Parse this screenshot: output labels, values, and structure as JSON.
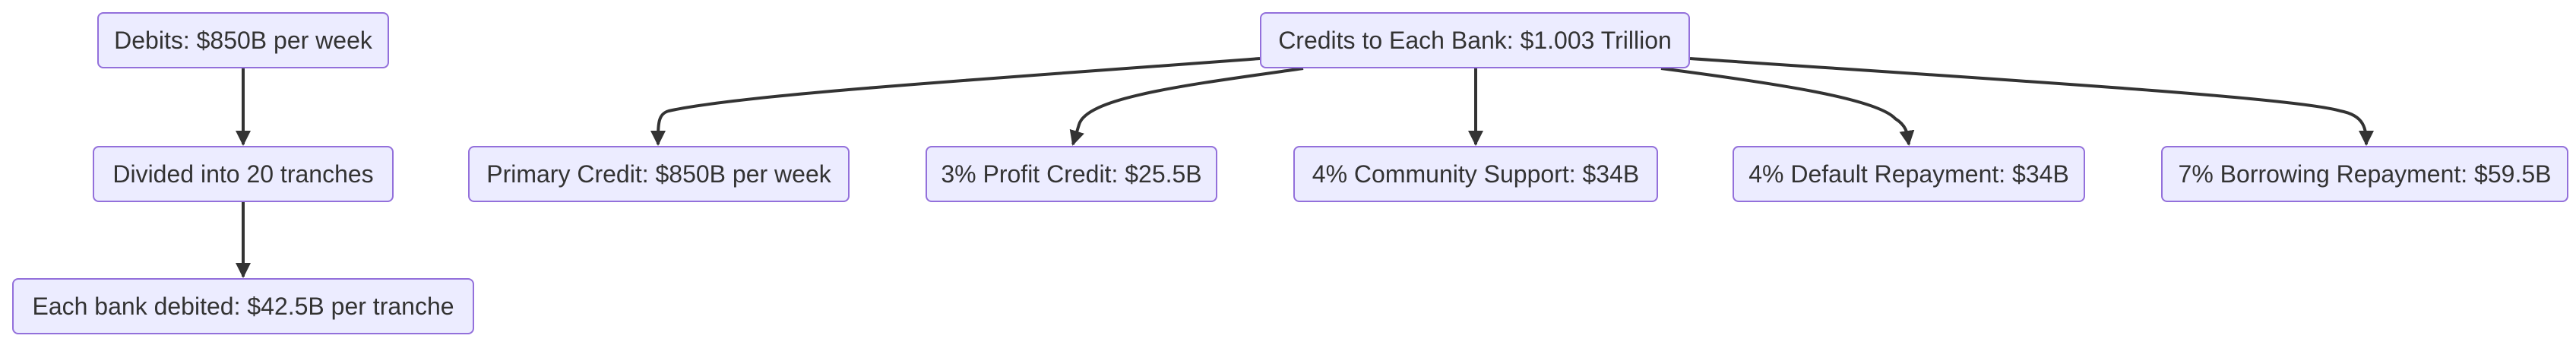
{
  "diagram": {
    "debits": "Debits: $850B per week",
    "tranches": "Divided into 20 tranches",
    "per_bank_debit": "Each bank debited: $42.5B per tranche",
    "credits": "Credits to Each Bank: $1.003 Trillion",
    "primary_credit": "Primary Credit: $850B per week",
    "profit_credit": "3% Profit Credit: $25.5B",
    "community_support": "4% Community Support: $34B",
    "default_repayment": "4% Default Repayment: $34B",
    "borrowing_repayment": "7% Borrowing Repayment: $59.5B"
  },
  "colors": {
    "node_fill": "#ECECFF",
    "node_border": "#9370DB",
    "text": "#333333",
    "edge": "#333333"
  }
}
